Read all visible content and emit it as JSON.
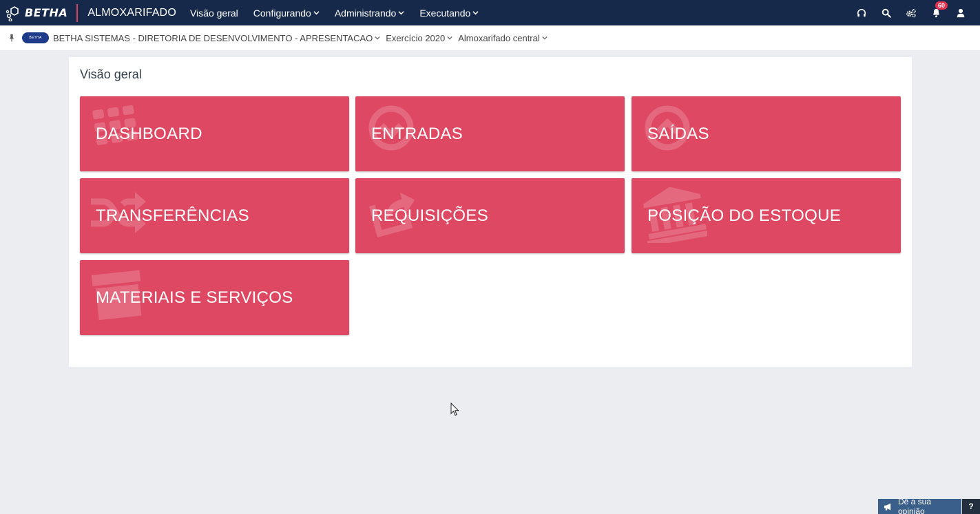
{
  "topbar": {
    "brand": "BETHA",
    "app_name": "ALMOXARIFADO",
    "nav": [
      {
        "label": "Visão geral",
        "dropdown": false
      },
      {
        "label": "Configurando",
        "dropdown": true
      },
      {
        "label": "Administrando",
        "dropdown": true
      },
      {
        "label": "Executando",
        "dropdown": true
      }
    ],
    "icons": [
      "headset-icon",
      "search-icon",
      "cogs-icon",
      "bell-icon",
      "user-icon"
    ],
    "notification_count": "60",
    "background_color": "#16294a"
  },
  "context": {
    "entity_logo_text": "BETHA",
    "entity": "BETHA SISTEMAS - DIRETORIA DE DESENVOLVIMENTO - APRESENTACAO",
    "exercise": "Exercício 2020",
    "warehouse": "Almoxarifado central"
  },
  "panel": {
    "title": "Visão geral",
    "tiles": [
      {
        "label": "DASHBOARD",
        "icon": "grid-icon"
      },
      {
        "label": "ENTRADAS",
        "icon": "arrow-circle-down-icon"
      },
      {
        "label": "SAÍDAS",
        "icon": "arrow-circle-up-icon"
      },
      {
        "label": "TRANSFERÊNCIAS",
        "icon": "shuffle-icon"
      },
      {
        "label": "REQUISIÇÕES",
        "icon": "share-square-icon"
      },
      {
        "label": "POSIÇÃO DO ESTOQUE",
        "icon": "bank-icon"
      },
      {
        "label": "MATERIAIS E SERVIÇOS",
        "icon": "archive-icon"
      }
    ],
    "tile_color": "#de4862"
  },
  "feedback": {
    "label": "Dê a sua opinião",
    "help": "?"
  }
}
